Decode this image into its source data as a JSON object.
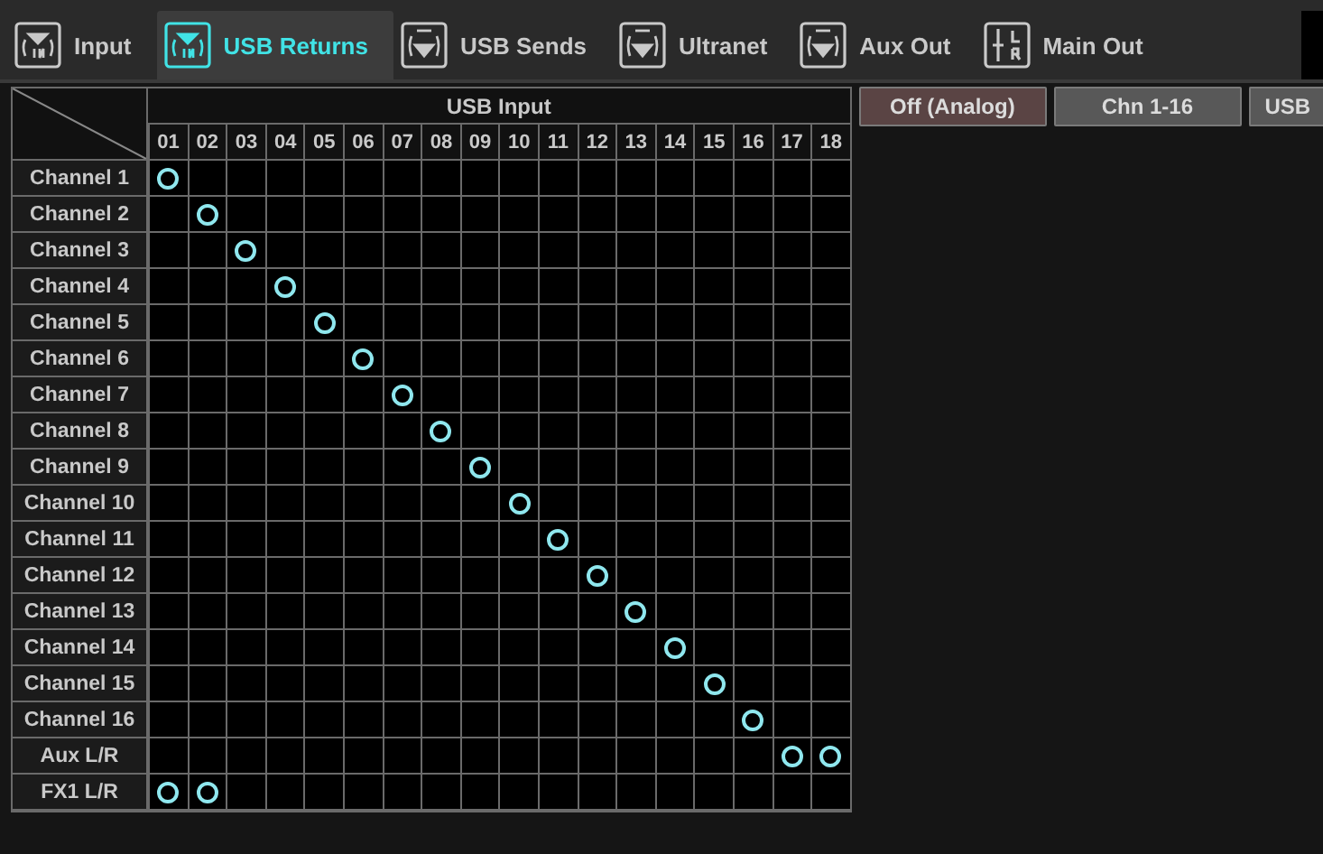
{
  "tabs": [
    {
      "label": "Input",
      "kind": "in",
      "selected": false
    },
    {
      "label": "USB Returns",
      "kind": "in",
      "selected": true
    },
    {
      "label": "USB Sends",
      "kind": "out",
      "selected": false
    },
    {
      "label": "Ultranet",
      "kind": "out",
      "selected": false
    },
    {
      "label": "Aux Out",
      "kind": "out",
      "selected": false
    },
    {
      "label": "Main Out",
      "kind": "main",
      "selected": false
    }
  ],
  "matrix": {
    "title": "USB Input",
    "columns": [
      "01",
      "02",
      "03",
      "04",
      "05",
      "06",
      "07",
      "08",
      "09",
      "10",
      "11",
      "12",
      "13",
      "14",
      "15",
      "16",
      "17",
      "18"
    ],
    "rows": [
      {
        "label": "Channel 1",
        "routed": [
          true,
          false,
          false,
          false,
          false,
          false,
          false,
          false,
          false,
          false,
          false,
          false,
          false,
          false,
          false,
          false,
          false,
          false
        ]
      },
      {
        "label": "Channel 2",
        "routed": [
          false,
          true,
          false,
          false,
          false,
          false,
          false,
          false,
          false,
          false,
          false,
          false,
          false,
          false,
          false,
          false,
          false,
          false
        ]
      },
      {
        "label": "Channel 3",
        "routed": [
          false,
          false,
          true,
          false,
          false,
          false,
          false,
          false,
          false,
          false,
          false,
          false,
          false,
          false,
          false,
          false,
          false,
          false
        ]
      },
      {
        "label": "Channel 4",
        "routed": [
          false,
          false,
          false,
          true,
          false,
          false,
          false,
          false,
          false,
          false,
          false,
          false,
          false,
          false,
          false,
          false,
          false,
          false
        ]
      },
      {
        "label": "Channel 5",
        "routed": [
          false,
          false,
          false,
          false,
          true,
          false,
          false,
          false,
          false,
          false,
          false,
          false,
          false,
          false,
          false,
          false,
          false,
          false
        ]
      },
      {
        "label": "Channel 6",
        "routed": [
          false,
          false,
          false,
          false,
          false,
          true,
          false,
          false,
          false,
          false,
          false,
          false,
          false,
          false,
          false,
          false,
          false,
          false
        ]
      },
      {
        "label": "Channel 7",
        "routed": [
          false,
          false,
          false,
          false,
          false,
          false,
          true,
          false,
          false,
          false,
          false,
          false,
          false,
          false,
          false,
          false,
          false,
          false
        ]
      },
      {
        "label": "Channel 8",
        "routed": [
          false,
          false,
          false,
          false,
          false,
          false,
          false,
          true,
          false,
          false,
          false,
          false,
          false,
          false,
          false,
          false,
          false,
          false
        ]
      },
      {
        "label": "Channel 9",
        "routed": [
          false,
          false,
          false,
          false,
          false,
          false,
          false,
          false,
          true,
          false,
          false,
          false,
          false,
          false,
          false,
          false,
          false,
          false
        ]
      },
      {
        "label": "Channel 10",
        "routed": [
          false,
          false,
          false,
          false,
          false,
          false,
          false,
          false,
          false,
          true,
          false,
          false,
          false,
          false,
          false,
          false,
          false,
          false
        ]
      },
      {
        "label": "Channel 11",
        "routed": [
          false,
          false,
          false,
          false,
          false,
          false,
          false,
          false,
          false,
          false,
          true,
          false,
          false,
          false,
          false,
          false,
          false,
          false
        ]
      },
      {
        "label": "Channel 12",
        "routed": [
          false,
          false,
          false,
          false,
          false,
          false,
          false,
          false,
          false,
          false,
          false,
          true,
          false,
          false,
          false,
          false,
          false,
          false
        ]
      },
      {
        "label": "Channel 13",
        "routed": [
          false,
          false,
          false,
          false,
          false,
          false,
          false,
          false,
          false,
          false,
          false,
          false,
          true,
          false,
          false,
          false,
          false,
          false
        ]
      },
      {
        "label": "Channel 14",
        "routed": [
          false,
          false,
          false,
          false,
          false,
          false,
          false,
          false,
          false,
          false,
          false,
          false,
          false,
          true,
          false,
          false,
          false,
          false
        ]
      },
      {
        "label": "Channel 15",
        "routed": [
          false,
          false,
          false,
          false,
          false,
          false,
          false,
          false,
          false,
          false,
          false,
          false,
          false,
          false,
          true,
          false,
          false,
          false
        ]
      },
      {
        "label": "Channel 16",
        "routed": [
          false,
          false,
          false,
          false,
          false,
          false,
          false,
          false,
          false,
          false,
          false,
          false,
          false,
          false,
          false,
          true,
          false,
          false
        ]
      },
      {
        "label": "Aux L/R",
        "routed": [
          false,
          false,
          false,
          false,
          false,
          false,
          false,
          false,
          false,
          false,
          false,
          false,
          false,
          false,
          false,
          false,
          true,
          true
        ]
      },
      {
        "label": "FX1 L/R",
        "routed": [
          true,
          true,
          false,
          false,
          false,
          false,
          false,
          false,
          false,
          false,
          false,
          false,
          false,
          false,
          false,
          false,
          false,
          false
        ]
      }
    ]
  },
  "sources": [
    {
      "label": "Off (Analog)",
      "selected": true
    },
    {
      "label": "Chn 1-16",
      "selected": false
    },
    {
      "label": "USB",
      "selected": false
    }
  ]
}
